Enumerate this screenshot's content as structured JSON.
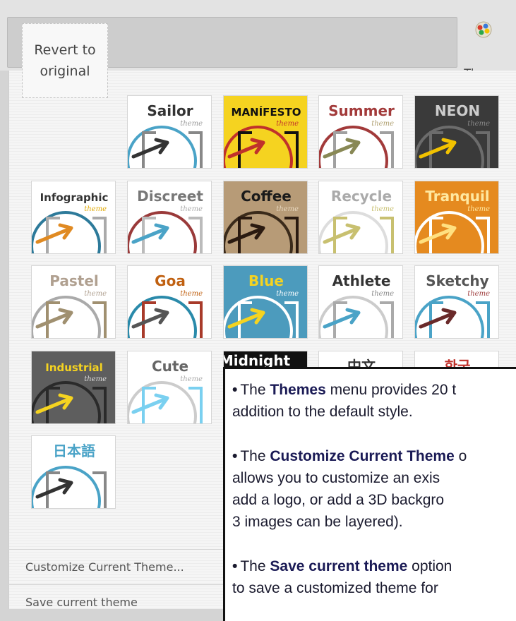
{
  "toolbar": {
    "themes_label": "Themes",
    "themes_icon": "palette-icon"
  },
  "revert_label": "Revert to\noriginal",
  "themes": [
    {
      "name": "Sailor",
      "sub": "theme",
      "bg": "#ffffff",
      "ring": "#4aa3c7",
      "arrow": "#333333",
      "bracket": "#888888",
      "text": "#333333",
      "sub_color": "#999999"
    },
    {
      "name": "MANÍFESTO",
      "sub": "theme",
      "bg": "#f5d320",
      "ring": "#c0312b",
      "arrow": "#c0312b",
      "bracket": "#111111",
      "text": "#111111",
      "sub_color": "#c0312b"
    },
    {
      "name": "Summer",
      "sub": "theme",
      "bg": "#ffffff",
      "ring": "#a23a3a",
      "arrow": "#888855",
      "bracket": "#a0a0a0",
      "text": "#a23a3a",
      "sub_color": "#b0a070"
    },
    {
      "name": "NEON",
      "sub": "theme",
      "bg": "#3a3a3a",
      "ring": "#6c6c6c",
      "arrow": "#f2c200",
      "bracket": "#6c6c6c",
      "text": "#cccccc",
      "sub_color": "#888888"
    },
    {
      "name": "Infographic",
      "sub": "theme",
      "bg": "#ffffff",
      "ring": "#2d7a9a",
      "arrow": "#e08a22",
      "bracket": "#aaaaaa",
      "text": "#333333",
      "sub_color": "#e0a800"
    },
    {
      "name": "Discreet",
      "sub": "theme",
      "bg": "#ffffff",
      "ring": "#9a3a3a",
      "arrow": "#4aa3c7",
      "bracket": "#bbbbbb",
      "text": "#777777",
      "sub_color": "#aaaaaa"
    },
    {
      "name": "Coffee",
      "sub": "theme",
      "bg": "#b79b77",
      "ring": "#3a2a1a",
      "arrow": "#2a1a10",
      "bracket": "#2a1a10",
      "text": "#1a1a1a",
      "sub_color": "#e8d8c0"
    },
    {
      "name": "Recycle",
      "sub": "theme",
      "bg": "#ffffff",
      "ring": "#dddddd",
      "arrow": "#c8c070",
      "bracket": "#c8c070",
      "text": "#aaaaaa",
      "sub_color": "#c8c070"
    },
    {
      "name": "Tranquil",
      "sub": "theme",
      "bg": "#e58a1f",
      "ring": "#ffffff",
      "arrow": "#ffe080",
      "bracket": "#ffffff",
      "text": "#ffe8a0",
      "sub_color": "#ffe8a0"
    },
    {
      "name": "Pastel",
      "sub": "theme",
      "bg": "#ffffff",
      "ring": "#aaaaaa",
      "arrow": "#a09070",
      "bracket": "#a09070",
      "text": "#b0a090",
      "sub_color": "#b0a090"
    },
    {
      "name": "Goa",
      "sub": "theme",
      "bg": "#ffffff",
      "ring": "#2a8aaa",
      "arrow": "#555555",
      "bracket": "#a83a2a",
      "text": "#c06010",
      "sub_color": "#c06010"
    },
    {
      "name": "Blue",
      "sub": "theme",
      "bg": "#4c9bbd",
      "ring": "#ffffff",
      "arrow": "#f5d320",
      "bracket": "#ffffff",
      "text": "#f5d320",
      "sub_color": "#ffffff"
    },
    {
      "name": "Athlete",
      "sub": "theme",
      "bg": "#ffffff",
      "ring": "#cccccc",
      "arrow": "#4aa3c7",
      "bracket": "#aaaaaa",
      "text": "#333333",
      "sub_color": "#888888"
    },
    {
      "name": "Sketchy",
      "sub": "theme",
      "bg": "#ffffff",
      "ring": "#4aa3c7",
      "arrow": "#6a2a2a",
      "bracket": "#4aa3c7",
      "text": "#555555",
      "sub_color": "#a04040"
    },
    {
      "name": "Industrial",
      "sub": "theme",
      "bg": "#5e5e5e",
      "ring": "#2a2a2a",
      "arrow": "#f5d320",
      "bracket": "#2a2a2a",
      "text": "#f5d320",
      "sub_color": "#dddddd"
    },
    {
      "name": "Cute",
      "sub": "theme",
      "bg": "#ffffff",
      "ring": "#cccccc",
      "arrow": "#7ad0f0",
      "bracket": "#7ad0f0",
      "text": "#666666",
      "sub_color": "#aaaaaa"
    },
    {
      "name": "Midnight",
      "sub": "",
      "bg": "#111111",
      "ring": "#111111",
      "arrow": "#111111",
      "bracket": "#111111",
      "text": "#ffffff",
      "sub_color": "#ffffff"
    },
    {
      "name": "中文",
      "sub": "",
      "bg": "#ffffff",
      "ring": "#cccccc",
      "arrow": "#333333",
      "bracket": "#888888",
      "text": "#333333",
      "sub_color": "#888888"
    },
    {
      "name": "한국",
      "sub": "",
      "bg": "#ffffff",
      "ring": "#cccccc",
      "arrow": "#c0312b",
      "bracket": "#888888",
      "text": "#c0312b",
      "sub_color": "#888888"
    },
    {
      "name": "日本語",
      "sub": "",
      "bg": "#ffffff",
      "ring": "#4aa3c7",
      "arrow": "#333333",
      "bracket": "#888888",
      "text": "#4aa3c7",
      "sub_color": "#888888"
    }
  ],
  "menu": {
    "customize": "Customize Current Theme...",
    "save": "Save current theme"
  },
  "callout": [
    {
      "pre": "The ",
      "bold": "Themes",
      "post": " menu provides 20 t",
      "line2": "addition to the default style."
    },
    {
      "pre": "The ",
      "bold": "Customize Current Theme",
      "post": " o",
      "line2": "allows you to customize an exis",
      "line3": "add a logo, or add a 3D backgro",
      "line4": "3 images can be layered)."
    },
    {
      "pre": "The ",
      "bold": "Save current theme",
      "post": " option",
      "line2": "to save a customized theme for"
    }
  ]
}
